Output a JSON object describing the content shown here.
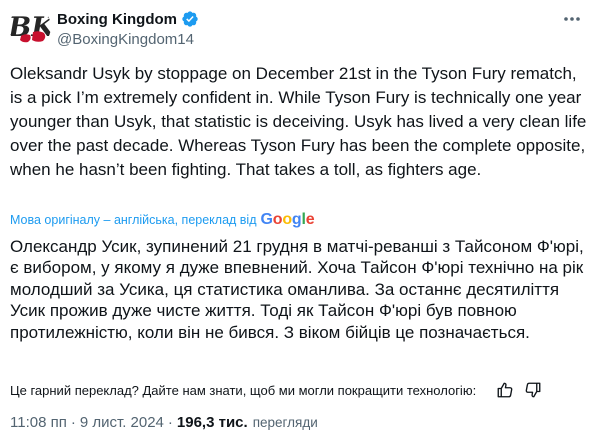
{
  "author": {
    "display_name": "Boxing Kingdom",
    "handle": "@BoxingKingdom14",
    "avatar_text": "BK",
    "verified": true,
    "verified_color": "#1d9bf0"
  },
  "tweet": {
    "text": "Oleksandr Usyk by stoppage on December 21st in the Tyson Fury rematch, is a pick I’m extremely confident in. While Tyson Fury is technically one year younger than Usyk, that statistic is deceiving. Usyk has lived a very clean life over the past decade. Whereas Tyson Fury has been the complete opposite, when he hasn’t been fighting. That takes a toll, as fighters age."
  },
  "translation": {
    "label": "Мова оригіналу – англійська, переклад від",
    "provider": "Google",
    "text": "Олександр Усик, зупинений 21 грудня в матчі-реванші з Тайсоном Ф'юрі, є вибором, у якому я дуже впевнений. Хоча Тайсон Ф'юрі технічно на рік молодший за Усика, ця статистика оманлива. За останнє десятиліття Усик прожив дуже чисте життя. Тоді як Тайсон Ф'юрі був повною протилежністю, коли він не бився. З віком бійців це позначається.",
    "feedback_prompt": "Це гарний переклад? Дайте нам знати, щоб ми могли покращити технологію:"
  },
  "meta": {
    "time": "11:08 пп",
    "date": "9 лист. 2024",
    "separator": "·",
    "views_count": "196,3 тис.",
    "views_label": "перегляди"
  },
  "colors": {
    "text": "#0f1419",
    "secondary": "#536471",
    "link": "#1d9bf0"
  },
  "icons": [
    "verified-badge-icon",
    "more-options-icon",
    "thumbs-up-icon",
    "thumbs-down-icon"
  ]
}
